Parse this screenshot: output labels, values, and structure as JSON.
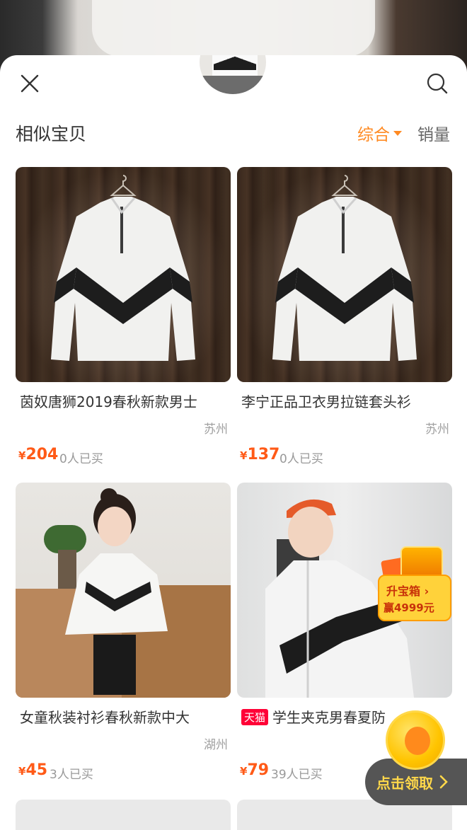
{
  "header": {
    "title": "相似宝贝",
    "sort_options": [
      {
        "label": "综合",
        "active": true
      },
      {
        "label": "销量",
        "active": false
      }
    ]
  },
  "products": [
    {
      "name": "茵奴唐狮2019春秋新款男士",
      "location": "苏州",
      "currency": "¥",
      "price": "204",
      "sold": "0人已买",
      "tmall": false
    },
    {
      "name": "李宁正品卫衣男拉链套头衫",
      "location": "苏州",
      "currency": "¥",
      "price": "137",
      "sold": "0人已买",
      "tmall": false
    },
    {
      "name": "女童秋装衬衫春秋新款中大",
      "location": "湖州",
      "currency": "¥",
      "price": "45",
      "sold": "3人已买",
      "tmall": false
    },
    {
      "name": "学生夹克男春夏防",
      "location": "",
      "currency": "¥",
      "price": "79",
      "sold": "39人已买",
      "tmall": true,
      "tag": "天猫"
    }
  ],
  "promo": {
    "line1": "升宝箱 ›",
    "line2": "赢4999元"
  },
  "claim": {
    "label": "点击领取"
  },
  "colors": {
    "accent": "#ff8a22",
    "price": "#ff5a17",
    "tmall": "#ff0036"
  }
}
